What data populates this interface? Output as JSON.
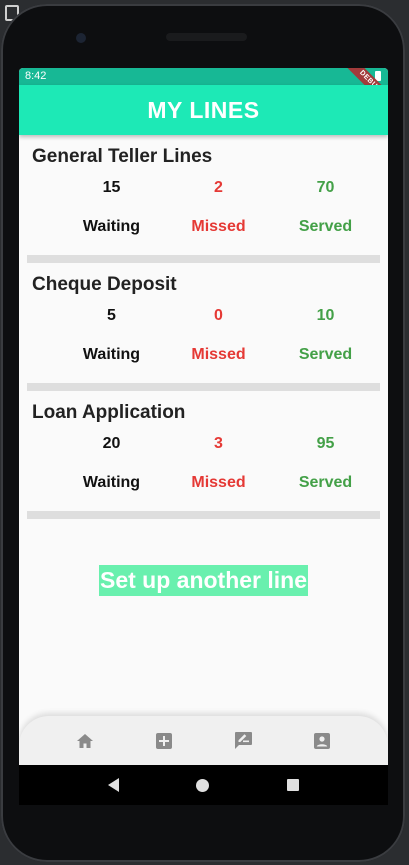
{
  "status_bar": {
    "time": "8:42",
    "debug_label": "DEBUG"
  },
  "app_bar": {
    "title": "MY LINES"
  },
  "lines": [
    {
      "title": "General Teller Lines",
      "waiting": "15",
      "missed": "2",
      "served": "70",
      "waiting_label": "Waiting",
      "missed_label": "Missed",
      "served_label": "Served"
    },
    {
      "title": "Cheque Deposit",
      "waiting": "5",
      "missed": "0",
      "served": "10",
      "waiting_label": "Waiting",
      "missed_label": "Missed",
      "served_label": "Served"
    },
    {
      "title": "Loan Application",
      "waiting": "20",
      "missed": "3",
      "served": "95",
      "waiting_label": "Waiting",
      "missed_label": "Missed",
      "served_label": "Served"
    }
  ],
  "setup_button": {
    "label": "Set up another line"
  },
  "bottom_nav": {
    "items": [
      {
        "icon": "home-icon"
      },
      {
        "icon": "add-box-icon"
      },
      {
        "icon": "rate-review-icon"
      },
      {
        "icon": "account-box-icon"
      }
    ]
  },
  "system_nav": {
    "icons": [
      "back-icon",
      "home-circle-icon",
      "recents-icon"
    ]
  },
  "colors": {
    "status_bar": "#17b895",
    "app_bar": "#1de9b6",
    "missed": "#e53935",
    "served": "#43a047",
    "setup_button_bg": "#69f0ae",
    "nav_icon": "#8a8a8a"
  }
}
